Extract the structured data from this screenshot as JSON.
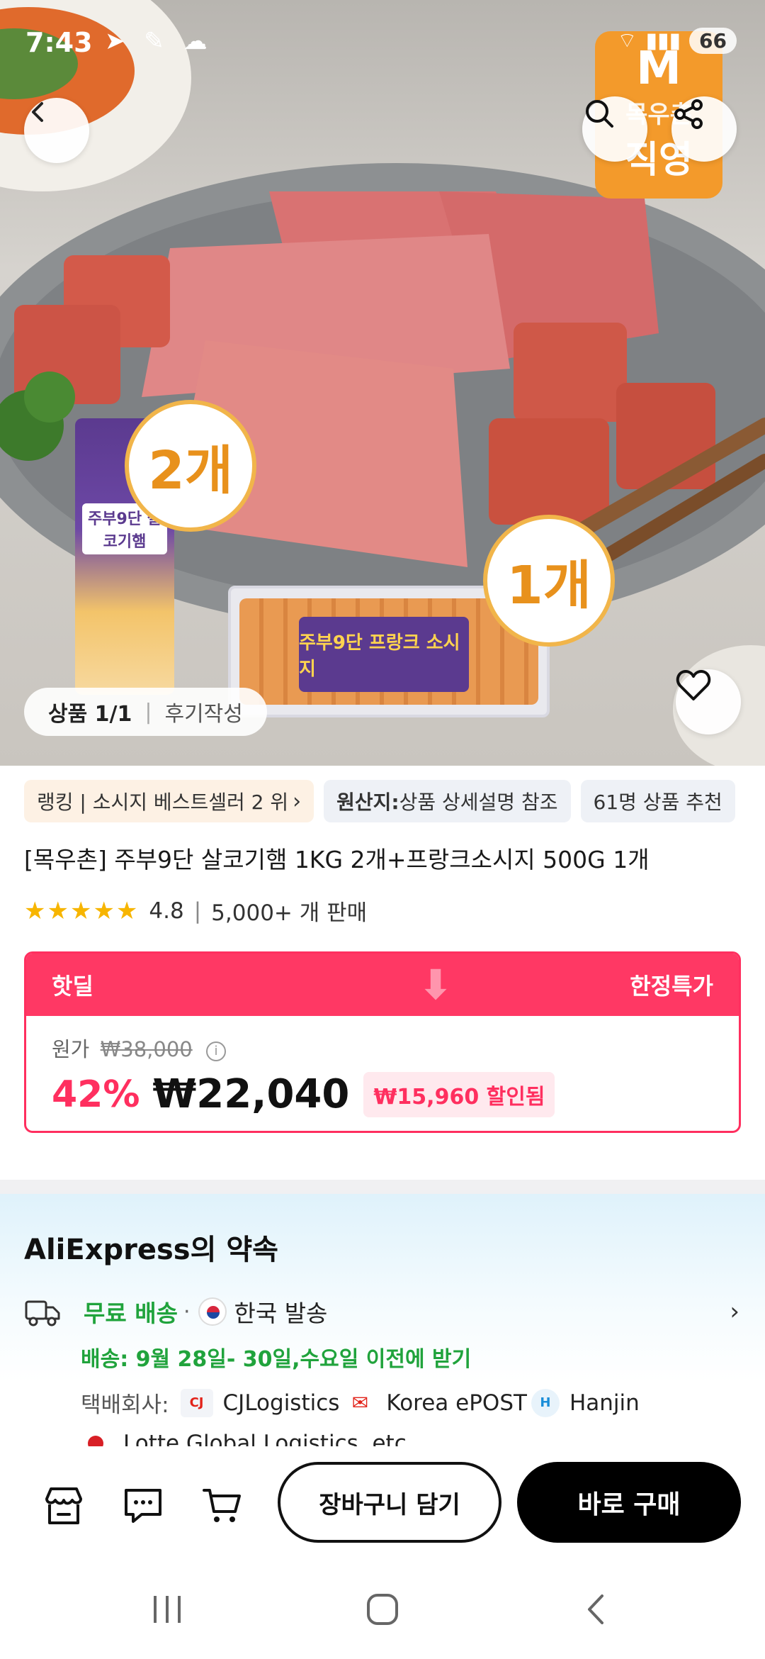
{
  "status_bar": {
    "time": "7:43",
    "battery": "66"
  },
  "hero": {
    "brand_badge": {
      "line1": "목우촌",
      "line2": "직영"
    },
    "count_two": "2개",
    "count_one": "1개",
    "package_tall_label": "주부9단 살코기햄",
    "package_wide_label": "주부9단 프랑크 소시지",
    "image_counter": "상품 1/1",
    "write_review": "후기작성"
  },
  "chips": {
    "ranking": "랭킹 | 소시지 베스트셀러 2 위",
    "origin_label": "원산지:",
    "origin_value": " 상품 상세설명 참조",
    "recommend": "61명 상품 추천"
  },
  "product": {
    "title": "[목우촌] 주부9단 살코기햄 1KG 2개+프랑크소시지 500G 1개",
    "rating": "4.8",
    "sold": "5,000+ 개 판매"
  },
  "deal": {
    "label": "핫딜",
    "tag": "한정특가",
    "original_label": "원가",
    "original_price": "₩38,000",
    "discount": "42%",
    "price": "₩22,040",
    "saved": "₩15,960 할인됨"
  },
  "promise": {
    "title": "AliExpress의 약속",
    "free_shipping": "무료 배송",
    "ship_from": "한국 발송",
    "delivery": "배송: 9월 28일- 30일,수요일 이전에 받기",
    "carriers_label": "택배회사:",
    "carriers": [
      "CJLogistics",
      "Korea ePOST",
      "Hanjin"
    ],
    "carriers_more": "Lotte Global Logistics ,etc."
  },
  "bottom_bar": {
    "add_to_cart": "장바구니 담기",
    "buy_now": "바로 구매"
  },
  "colors": {
    "accent": "#ff3864",
    "shipping_green": "#20a33c",
    "star": "#f7b500"
  }
}
